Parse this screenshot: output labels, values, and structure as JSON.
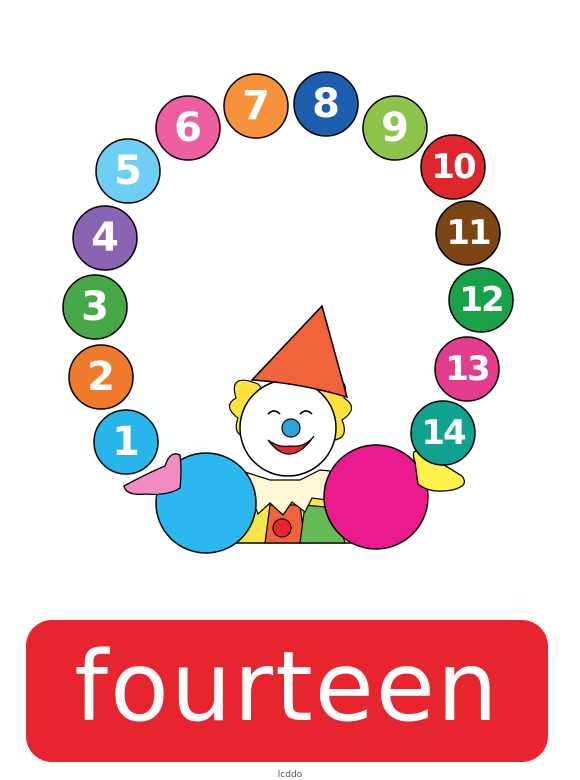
{
  "card": {
    "word": "fourteen",
    "footer": "lcddo",
    "banner_color": "#e6252f"
  },
  "balls": [
    {
      "label": "1",
      "color": "#27b5ea"
    },
    {
      "label": "2",
      "color": "#f07a2b"
    },
    {
      "label": "3",
      "color": "#47a848"
    },
    {
      "label": "4",
      "color": "#8a64b3"
    },
    {
      "label": "5",
      "color": "#6ecff4"
    },
    {
      "label": "6",
      "color": "#ef5ea0"
    },
    {
      "label": "7",
      "color": "#f6923a"
    },
    {
      "label": "8",
      "color": "#1b5fae"
    },
    {
      "label": "9",
      "color": "#8dc54b"
    },
    {
      "label": "10",
      "color": "#e0262d"
    },
    {
      "label": "11",
      "color": "#7b4514"
    },
    {
      "label": "12",
      "color": "#17a24a"
    },
    {
      "label": "13",
      "color": "#e33b8e"
    },
    {
      "label": "14",
      "color": "#0fa290"
    }
  ],
  "clown": {
    "hat_color": "#f0623a",
    "hair_color": "#ffe23a",
    "nose_color": "#2aa6dd",
    "left_ball_color": "#2ab8ee",
    "right_ball_color": "#ec1a8f",
    "left_glove_color": "#f28bc0",
    "right_glove_color": "#fff04a"
  }
}
